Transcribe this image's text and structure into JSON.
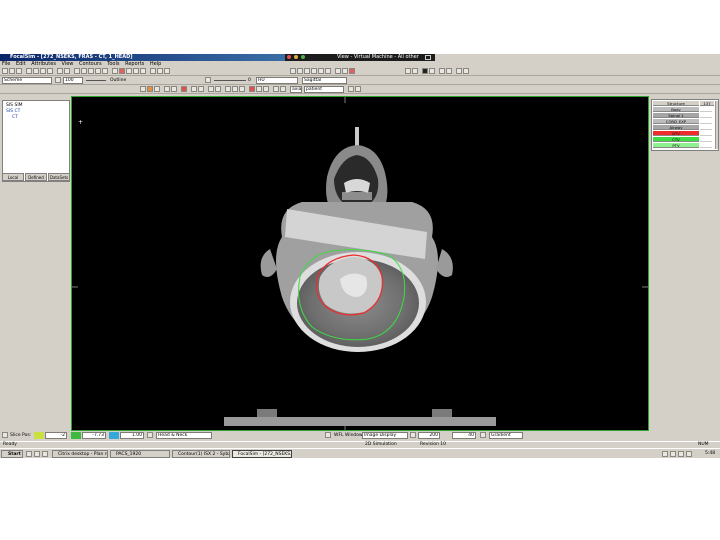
{
  "window": {
    "title": "FocalSim - [272_NSEKS, FRAS - CT, 1_HEAD]"
  },
  "vm_bar": {
    "title": "View - Virtual Machine - All other"
  },
  "menu": {
    "items": [
      "File",
      "Edit",
      "Attributes",
      "View",
      "Contours",
      "Tools",
      "Reports",
      "Help"
    ]
  },
  "toolbar1": {
    "scheme": "Scheme",
    "zoom": "100",
    "layer": "Outline",
    "slider_value": "0",
    "units": "HU",
    "view_mode": "Sagittal"
  },
  "toolbar2": {
    "orientation": "axial",
    "orientation_alt": "patient"
  },
  "left_panel": {
    "tree": [
      "SIS SIM",
      "SIS CT",
      "CT"
    ],
    "tabs": [
      "Local",
      "Defined",
      "DataSets"
    ]
  },
  "viewport": {
    "border_color": "#2ea12e",
    "cursor_mark": "+"
  },
  "structures": {
    "header": "Structure",
    "header_value": "137",
    "rows": [
      {
        "name": "Body",
        "color": "#bcbcbc"
      },
      {
        "name": "Spinal 1",
        "color": "#a5a5a5"
      },
      {
        "name": "CORD_EXP",
        "color": "#bcbcbc"
      },
      {
        "name": "Airway",
        "color": "#a5a5a5"
      },
      {
        "name": "GTV",
        "color": "#ee2c2c"
      },
      {
        "name": "CTV",
        "color": "#3ddc44"
      },
      {
        "name": "PTV",
        "color": "#8ef08f"
      }
    ]
  },
  "bottom_toolbar": {
    "scroll_label": "Slice Pos:",
    "slice_1": "-2",
    "slice_2": "-7.73",
    "zoom": "1.00",
    "window_preset": "Head & Neck",
    "extra": "WFL Window",
    "display": "Image Display",
    "levels": [
      "200",
      "40"
    ],
    "unit": "Gradient"
  },
  "status_bar": {
    "left": "Ready",
    "center": "2D Simulation",
    "right": "Revision 10",
    "right_far": "NUM"
  },
  "taskbar": {
    "start": "Start",
    "tasks": [
      "Citrix desktop - Plan review",
      "PACS_1920",
      "Contour(1) ISX 2 - Sybase",
      "FocalSim - [272_NSEKS..."
    ],
    "time": "5:48"
  }
}
